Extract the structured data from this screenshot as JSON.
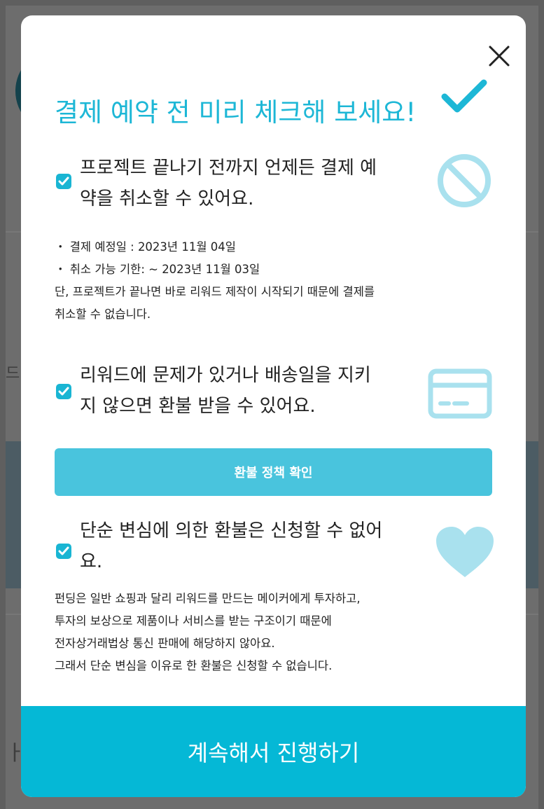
{
  "modal": {
    "title": "결제 예약 전 미리 체크해 보세요!",
    "sections": [
      {
        "heading_line1": "프로젝트 끝나기 전까지 언제든 결제 예",
        "heading_line2": "약을 취소할 수 있어요.",
        "icon": "prohibit-icon",
        "details": [
          "・ 결제 예정일 : 2023년 11월 04일",
          "・ 취소 가능 기한: ~ 2023년 11월 03일",
          "단, 프로젝트가 끝나면 바로 리워드 제작이 시작되기 때문에 결제를",
          "취소할 수 없습니다."
        ]
      },
      {
        "heading_line1": "리워드에 문제가 있거나 배송일을 지키",
        "heading_line2": "지 않으면 환불 받을 수 있어요.",
        "icon": "credit-card-icon",
        "button_label": "환불 정책 확인"
      },
      {
        "heading_line1": "단순 변심에 의한 환불은 신청할 수 없어",
        "heading_line2": "요.",
        "icon": "heart-icon",
        "details": [
          "펀딩은 일반 쇼핑과 달리 리워드를 만드는 메이커에게 투자하고,",
          "투자의 보상으로 제품이나 서비스를 받는 구조이기 때문에",
          "전자상거래법상 통신 판매에 해당하지 않아요.",
          "그래서 단순 변심을 이유로 한 환불은 신청할 수 없습니다."
        ]
      }
    ],
    "continue_label": "계속해서 진행하기"
  },
  "background": {
    "fragment_left_1": "드",
    "fragment_left_2": "ㅏ"
  },
  "colors": {
    "accent": "#1db7d6",
    "checkbox": "#19b5d3",
    "icon": "#a9e1ee",
    "refund_button": "#49c4dd",
    "continue_button": "#05b8d6"
  }
}
